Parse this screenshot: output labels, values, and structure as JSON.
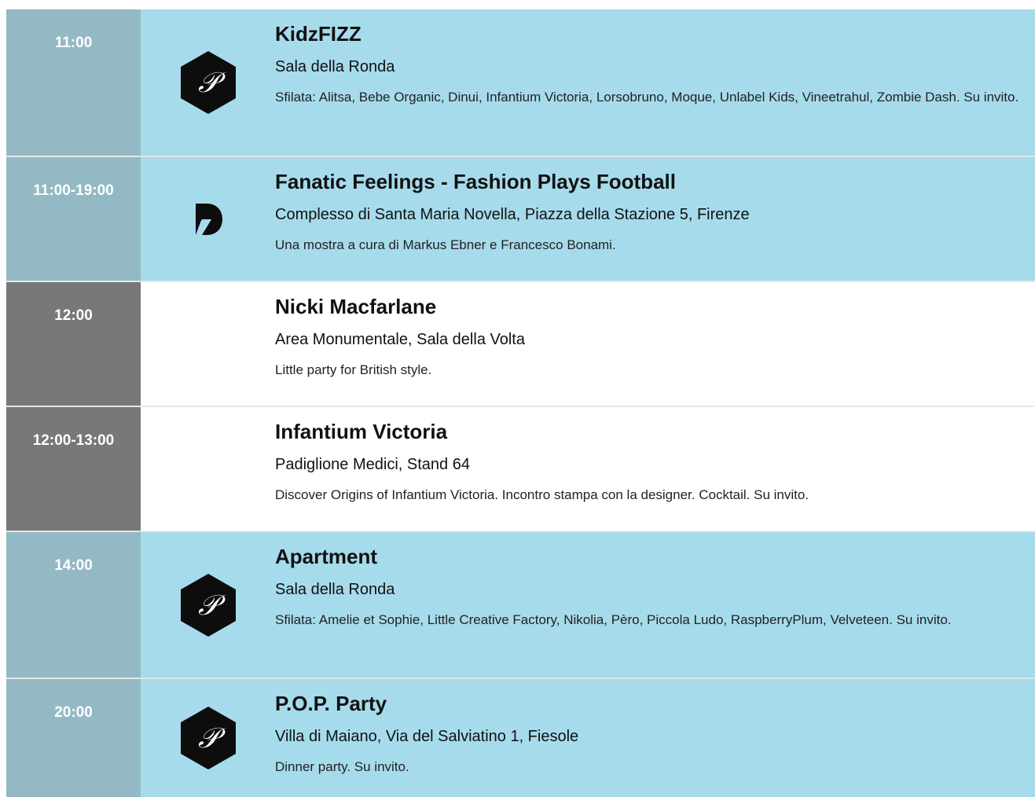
{
  "events": [
    {
      "time": "11:00",
      "logo": "pitti-p-hexagon-icon",
      "title": "KidzFIZZ",
      "venue": "Sala della Ronda",
      "description": "Sfilata: Alitsa, Bebe Organic, Dinui, Infantium Victoria, Lorsobruno, Moque, Unlabel Kids, Vineetrahul, Zombie Dash. Su invito."
    },
    {
      "time": "11:00-19:00",
      "logo": "pitti-discovery-icon",
      "title": "Fanatic Feelings - Fashion Plays Football",
      "venue": "Complesso di Santa Maria Novella, Piazza della Stazione 5, Firenze",
      "description": "Una mostra a cura di Markus Ebner e Francesco Bonami."
    },
    {
      "time": "12:00",
      "logo": "",
      "title": "Nicki Macfarlane",
      "venue": "Area Monumentale, Sala della Volta",
      "description": "Little party for British style."
    },
    {
      "time": "12:00-13:00",
      "logo": "",
      "title": "Infantium Victoria",
      "venue": "Padiglione Medici, Stand 64",
      "description": "Discover Origins of Infantium Victoria. Incontro stampa con la designer. Cocktail. Su invito."
    },
    {
      "time": "14:00",
      "logo": "pitti-p-hexagon-icon",
      "title": "Apartment",
      "venue": "Sala della Ronda",
      "description": "Sfilata: Amelie et Sophie, Little Creative Factory, Nikolia, Pèro, Piccola Ludo, RaspberryPlum, Velveteen. Su invito."
    },
    {
      "time": "20:00",
      "logo": "pitti-p-hexagon-icon",
      "title": "P.O.P. Party",
      "venue": "Villa di Maiano, Via del Salviatino 1, Fiesole",
      "description": "Dinner party. Su invito."
    }
  ],
  "colors": {
    "row_blue": "#a6dbec",
    "time_blue": "#93b9c4",
    "time_gray": "#787878",
    "divider": "#e6e6e6"
  }
}
